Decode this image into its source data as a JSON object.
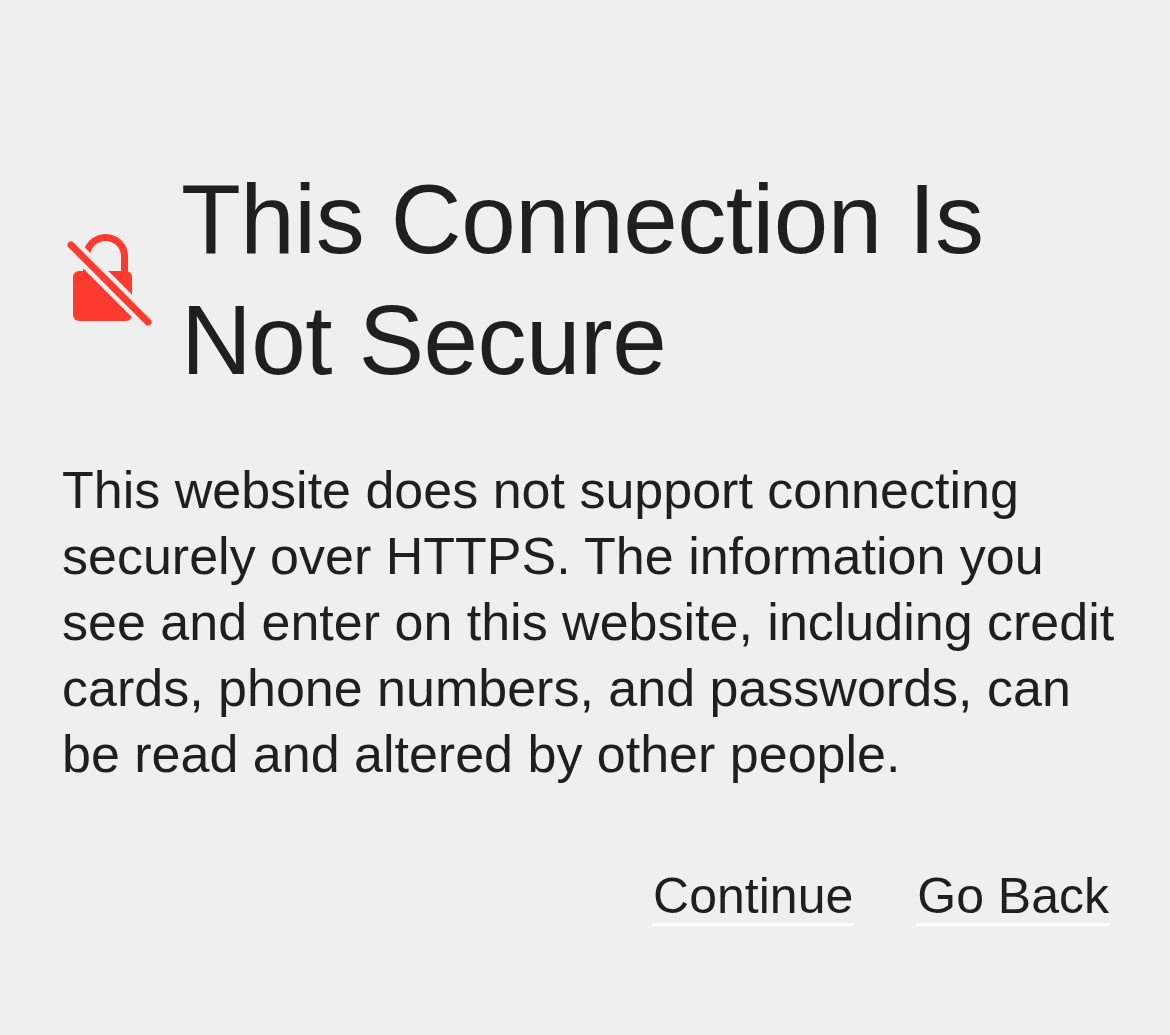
{
  "title": "This Connection Is Not Secure",
  "message": "This website does not support connecting securely over HTTPS. The information you see and enter on this website, including credit cards, phone numbers, and passwords, can be read and altered by other people.",
  "buttons": [
    {
      "label": "Continue"
    },
    {
      "label": "Go Back"
    }
  ]
}
